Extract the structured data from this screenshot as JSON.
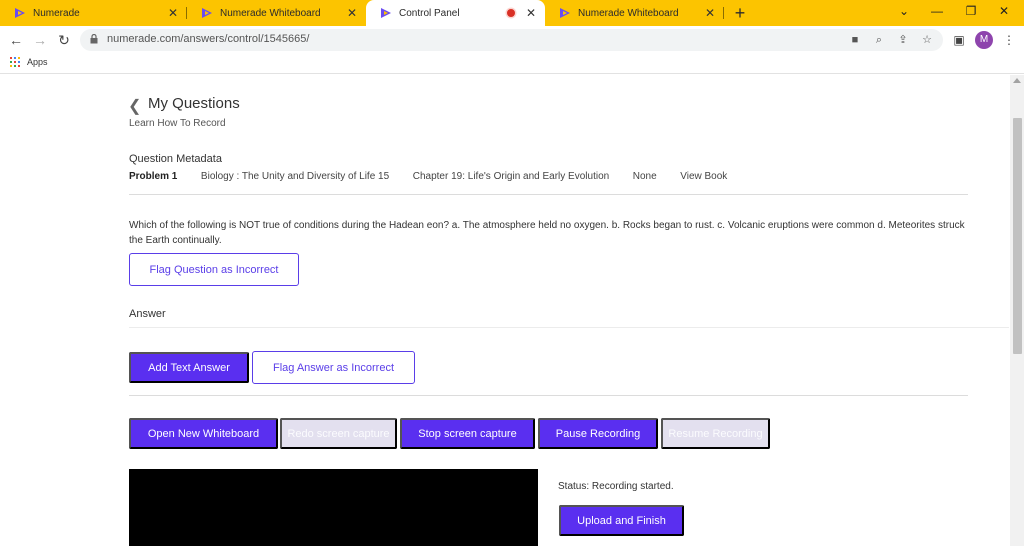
{
  "browser": {
    "tabs": [
      {
        "title": "Numerade"
      },
      {
        "title": "Numerade Whiteboard"
      },
      {
        "title": "Control Panel"
      },
      {
        "title": "Numerade Whiteboard"
      }
    ],
    "url": "numerade.com/answers/control/1545665/",
    "bookmarks": {
      "apps_label": "Apps"
    },
    "profile_initial": "M",
    "colors": {
      "tabstrip": "#fcc400",
      "accent": "#5a2ff0"
    }
  },
  "page": {
    "title": "My Questions",
    "learn_link": "Learn How To Record",
    "metadata": {
      "label": "Question Metadata",
      "problem": "Problem 1",
      "book": "Biology : The Unity and Diversity of Life 15",
      "chapter": "Chapter 19: Life's Origin and Early Evolution",
      "section": "None",
      "view_book": "View Book"
    },
    "question_text": "Which of the following is NOT true of conditions during the Hadean eon? a. The atmosphere held no oxygen. b. Rocks began to rust. c. Volcanic eruptions were common d. Meteorites struck the Earth continually.",
    "flag_question_label": "Flag Question as Incorrect",
    "answer_label": "Answer",
    "add_text_answer_label": "Add Text Answer",
    "flag_answer_label": "Flag Answer as Incorrect",
    "recording_buttons": {
      "open_whiteboard": "Open New Whiteboard",
      "redo_capture": "Redo screen capture",
      "stop_capture": "Stop screen capture",
      "pause_recording": "Pause Recording",
      "resume_recording": "Resume Recording"
    },
    "status_text": "Status: Recording started.",
    "upload_label": "Upload and Finish"
  }
}
